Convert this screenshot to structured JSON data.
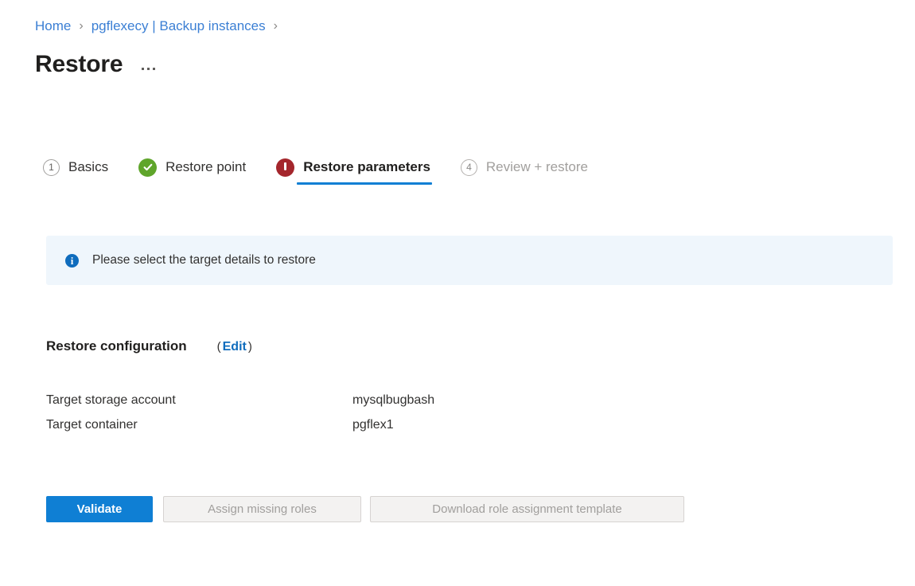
{
  "breadcrumb": {
    "separator": "›",
    "items": [
      {
        "label": "Home"
      },
      {
        "label": "pgflexecy | Backup instances"
      }
    ]
  },
  "header": {
    "title": "Restore",
    "more_actions_icon": "ellipsis-icon"
  },
  "wizard": {
    "steps": [
      {
        "id": "basics",
        "badge": "1",
        "badge_type": "number",
        "label": "Basics",
        "state": "incomplete"
      },
      {
        "id": "restore-point",
        "badge": "✓",
        "badge_type": "check",
        "label": "Restore point",
        "state": "complete"
      },
      {
        "id": "restore-parameters",
        "badge": "!",
        "badge_type": "error",
        "label": "Restore parameters",
        "state": "active"
      },
      {
        "id": "review-restore",
        "badge": "4",
        "badge_type": "number",
        "label": "Review + restore",
        "state": "disabled"
      }
    ],
    "active_underline_color": "#0f7fd4"
  },
  "info_banner": {
    "icon": "info-icon",
    "message": "Please select the target details to restore",
    "background": "#eff6fc",
    "icon_color": "#0f6cbd"
  },
  "restore_configuration": {
    "title": "Restore configuration",
    "paren_open": "(",
    "edit_label": "Edit",
    "paren_close": ")",
    "rows": [
      {
        "key": "Target storage account",
        "value": "mysqlbugbash"
      },
      {
        "key": "Target container",
        "value": "pgflex1"
      }
    ]
  },
  "actions": {
    "validate_label": "Validate",
    "assign_roles_label": "Assign missing roles",
    "download_template_label": "Download role assignment template",
    "primary_color": "#0f7fd4"
  }
}
